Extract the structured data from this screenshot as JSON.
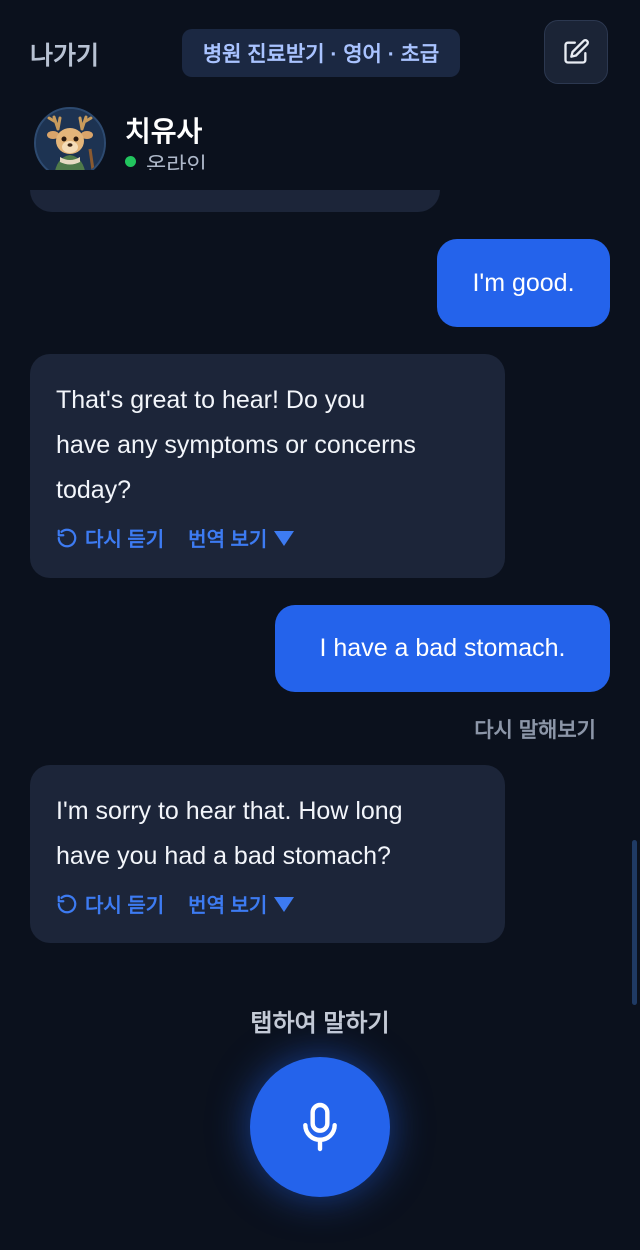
{
  "header": {
    "exit_label": "나가기",
    "title": "병원 진료받기 · 영어 · 초급",
    "edit_icon": "edit-square-icon"
  },
  "profile": {
    "name": "치유사",
    "status": "온라인",
    "status_color": "#22c55e",
    "avatar_icon": "deer-character-avatar"
  },
  "messages": [
    {
      "role": "user",
      "text": "I'm good."
    },
    {
      "role": "ai",
      "text": "That's great to hear! Do you\nhave any symptoms or concerns\ntoday?",
      "replay_label": "다시 듣기",
      "translate_label": "번역 보기"
    },
    {
      "role": "user",
      "text": "I have a bad stomach."
    },
    {
      "role": "ai",
      "text": "I'm sorry to hear that. How long\nhave you had a bad stomach?",
      "replay_label": "다시 듣기",
      "translate_label": "번역 보기"
    }
  ],
  "retry_label": "다시 말해보기",
  "tap_to_speak_label": "탭하여 말하기",
  "colors": {
    "background": "#0b111d",
    "accent": "#2463eb",
    "ai_bubble": "#1c2539",
    "link": "#3d7bf2"
  }
}
